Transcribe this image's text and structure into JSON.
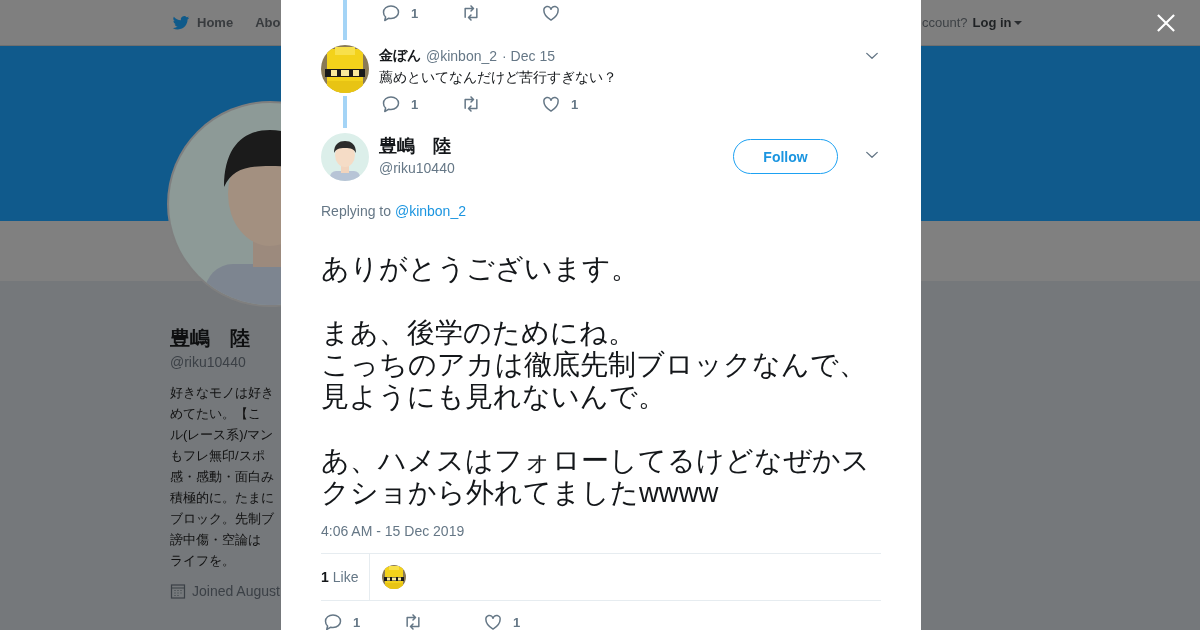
{
  "background_page": {
    "nav": [
      {
        "kind": "home",
        "label": "Home"
      },
      {
        "kind": "link",
        "label": "Abo"
      }
    ],
    "account_prompt": "ccount?",
    "login": "Log in",
    "profile": {
      "name": "豊嶋　陸",
      "handle": "@riku10440",
      "bio_lines": [
        "好きなモノは好き",
        "めてたい。【こ",
        "ル(レース系)/マン",
        "もフレ無印/スポ",
        "感・感動・面白み",
        "積極的に。たまに",
        "ブロック。先制ブ",
        "謗中傷・空論は",
        "ライフを。"
      ],
      "joined": "Joined August"
    }
  },
  "modal": {
    "thread": [
      {
        "kind": "tail",
        "actions": {
          "replies": "1"
        }
      },
      {
        "kind": "reply",
        "avatar": {
          "kind": "pixel"
        },
        "name": "金ぼん",
        "handle": "@kinbon_2",
        "date": "· Dec 15",
        "text": "薦めといてなんだけど苦行すぎない？",
        "actions": {
          "replies": "1",
          "likes": "1"
        }
      }
    ],
    "main_tweet": {
      "avatar": {
        "kind": "person"
      },
      "name": "豊嶋　陸",
      "handle": "@riku10440",
      "follow_button": "Follow",
      "replying_label": "Replying to",
      "replying_handle": "@kinbon_2",
      "paragraphs": [
        [
          "ありがとうございます。"
        ],
        [
          "まあ、後学のためにね。",
          "こっちのアカは徹底先制ブロックなんで、見ようにも見れないんで。"
        ],
        [
          "あ、ハメスはフォローしてるけどなぜかスクショから外れてましたwwww"
        ]
      ],
      "timestamp": "4:06 AM - 15 Dec 2019",
      "likes_count": "1",
      "likes_label": "Like",
      "liker_avatars": [
        {
          "kind": "pixel"
        }
      ],
      "actions": {
        "replies": "1",
        "likes": "1"
      }
    }
  }
}
